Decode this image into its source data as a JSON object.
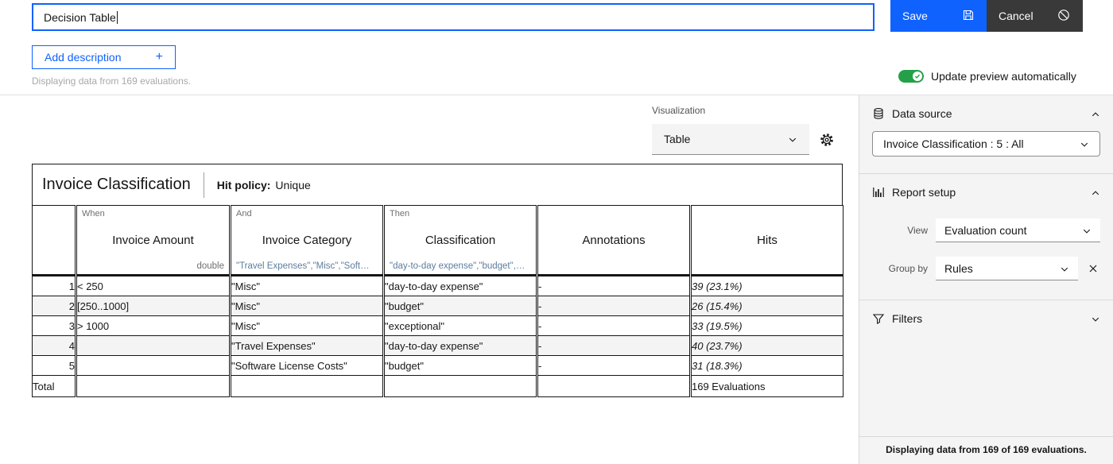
{
  "titlebar": {
    "title_value": "Decision Table",
    "save": "Save",
    "cancel": "Cancel",
    "add_description": "Add description",
    "plus": "+",
    "note": "Displaying data from 169 evaluations.",
    "auto_update": "Update preview automatically"
  },
  "preview": {
    "visualization_label": "Visualization",
    "visualization_value": "Table",
    "table": {
      "title": "Invoice Classification",
      "hit_policy_label": "Hit policy:",
      "hit_policy_value": "Unique",
      "columns": [
        {
          "keyword": "When",
          "label": "Invoice Amount",
          "hint": "double"
        },
        {
          "keyword": "And",
          "label": "Invoice Category",
          "hint": "\"Travel Expenses\",\"Misc\",\"Soft…"
        },
        {
          "keyword": "Then",
          "label": "Classification",
          "hint": "\"day-to-day expense\",\"budget\",…"
        },
        {
          "keyword": "",
          "label": "Annotations",
          "hint": ""
        },
        {
          "keyword": "",
          "label": "Hits",
          "hint": ""
        }
      ],
      "rows": [
        {
          "num": "1",
          "amount": "< 250",
          "category": "\"Misc\"",
          "classification": "\"day-to-day expense\"",
          "annotations": "-",
          "hits": "39 (23.1%)"
        },
        {
          "num": "2",
          "amount": "[250..1000]",
          "category": "\"Misc\"",
          "classification": "\"budget\"",
          "annotations": "-",
          "hits": "26 (15.4%)"
        },
        {
          "num": "3",
          "amount": "> 1000",
          "category": "\"Misc\"",
          "classification": "\"exceptional\"",
          "annotations": "-",
          "hits": "33 (19.5%)"
        },
        {
          "num": "4",
          "amount": "",
          "category": "\"Travel Expenses\"",
          "classification": "\"day-to-day expense\"",
          "annotations": "-",
          "hits": "40 (23.7%)"
        },
        {
          "num": "5",
          "amount": "",
          "category": "\"Software License Costs\"",
          "classification": "\"budget\"",
          "annotations": "-",
          "hits": "31 (18.3%)"
        }
      ],
      "total_label": "Total",
      "total_hits": "169 Evaluations"
    }
  },
  "sidebar": {
    "data_source_title": "Data source",
    "data_source_value": "Invoice Classification : 5 : All",
    "report_setup_title": "Report setup",
    "view_label": "View",
    "view_value": "Evaluation count",
    "group_by_label": "Group by",
    "group_by_value": "Rules",
    "filters_title": "Filters",
    "status": "Displaying data from 169 of 169 evaluations."
  },
  "colors": {
    "accent": "#0f62fe",
    "cancel_bg": "#393939",
    "toggle_on": "#24a148"
  }
}
